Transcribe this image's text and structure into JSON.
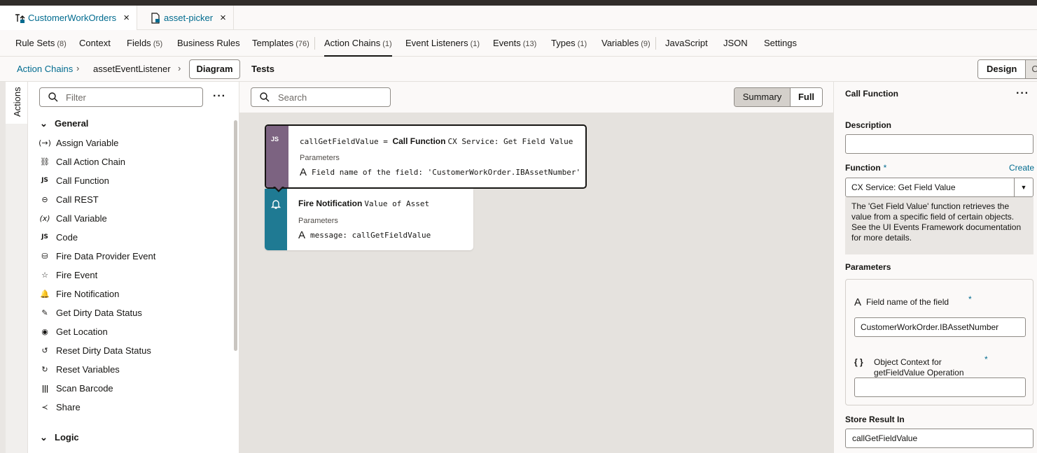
{
  "file_tabs": [
    {
      "label": "CustomerWorkOrders",
      "close": "×"
    },
    {
      "label": "asset-picker",
      "close": "×"
    }
  ],
  "nav_tabs": [
    {
      "label": "Rule Sets",
      "count": "(8)"
    },
    {
      "label": "Context",
      "count": ""
    },
    {
      "label": "Fields",
      "count": "(5)"
    },
    {
      "label": "Business Rules",
      "count": ""
    },
    {
      "label": "Templates",
      "count": "(76)"
    },
    {
      "label": "Action Chains",
      "count": "(1)"
    },
    {
      "label": "Event Listeners",
      "count": "(1)"
    },
    {
      "label": "Events",
      "count": "(13)"
    },
    {
      "label": "Types",
      "count": "(1)"
    },
    {
      "label": "Variables",
      "count": "(9)"
    },
    {
      "label": "JavaScript",
      "count": ""
    },
    {
      "label": "JSON",
      "count": ""
    },
    {
      "label": "Settings",
      "count": ""
    }
  ],
  "breadcrumb": {
    "root": "Action Chains",
    "current": "assetEventListener",
    "chevron": "›",
    "diagram_btn": "Diagram",
    "tests_btn": "Tests",
    "design_btn": "Design",
    "code_btn_partial": "C"
  },
  "left_panel": {
    "vertical_tab": "Actions",
    "filter_placeholder": "Filter",
    "kebab": "···",
    "groups": [
      {
        "title": "General",
        "items": [
          {
            "label": "Assign Variable",
            "icon": "(→)"
          },
          {
            "label": "Call Action Chain",
            "icon": "⛓"
          },
          {
            "label": "Call Function",
            "icon": "JS"
          },
          {
            "label": "Call REST",
            "icon": "⊖"
          },
          {
            "label": "Call Variable",
            "icon": "(x)"
          },
          {
            "label": "Code",
            "icon": "JS"
          },
          {
            "label": "Fire Data Provider Event",
            "icon": "⛁"
          },
          {
            "label": "Fire Event",
            "icon": "☆"
          },
          {
            "label": "Fire Notification",
            "icon": "🔔"
          },
          {
            "label": "Get Dirty Data Status",
            "icon": "✎"
          },
          {
            "label": "Get Location",
            "icon": "◉"
          },
          {
            "label": "Reset Dirty Data Status",
            "icon": "↺"
          },
          {
            "label": "Reset Variables",
            "icon": "↻"
          },
          {
            "label": "Scan Barcode",
            "icon": "|||"
          },
          {
            "label": "Share",
            "icon": "≺"
          }
        ]
      },
      {
        "title": "Logic",
        "items": []
      }
    ]
  },
  "canvas": {
    "search_placeholder": "Search",
    "summary_btn": "Summary",
    "full_btn": "Full",
    "nodes": [
      {
        "var_name": "callGetFieldValue",
        "equals": " = ",
        "action": "Call Function",
        "target": "CX Service: Get Field Value",
        "params_label": "Parameters",
        "param": "Field name of the field: 'CustomerWorkOrder.IBAssetNumber'",
        "band_icon": "JS"
      },
      {
        "action": "Fire Notification",
        "target": "Value of Asset",
        "params_label": "Parameters",
        "param": "message: callGetFieldValue",
        "band_icon": "🔔"
      }
    ]
  },
  "right_panel": {
    "title": "Call Function",
    "kebab": "···",
    "description_label": "Description",
    "description_value": "",
    "function_label": "Function",
    "required_mark": "*",
    "create_link": "Create",
    "function_value": "CX Service: Get Field Value",
    "help_text": "The 'Get Field Value' function retrieves the value from a specific field of certain objects. See the UI Events Framework documentation for more details.",
    "parameters_label": "Parameters",
    "param1_label": "Field name of the field",
    "param1_icon": "A",
    "param1_value": "CustomerWorkOrder.IBAssetNumber",
    "param2_label": "Object Context for getFieldValue Operation",
    "param2_icon": "{ }",
    "param2_value": "",
    "store_label": "Store Result In",
    "store_value": "callGetFieldValue"
  },
  "colors": {
    "accent": "#006b8f",
    "function_band": "#7c6381",
    "notification_band": "#1f7a93",
    "canvas_bg": "#e5e2de"
  }
}
